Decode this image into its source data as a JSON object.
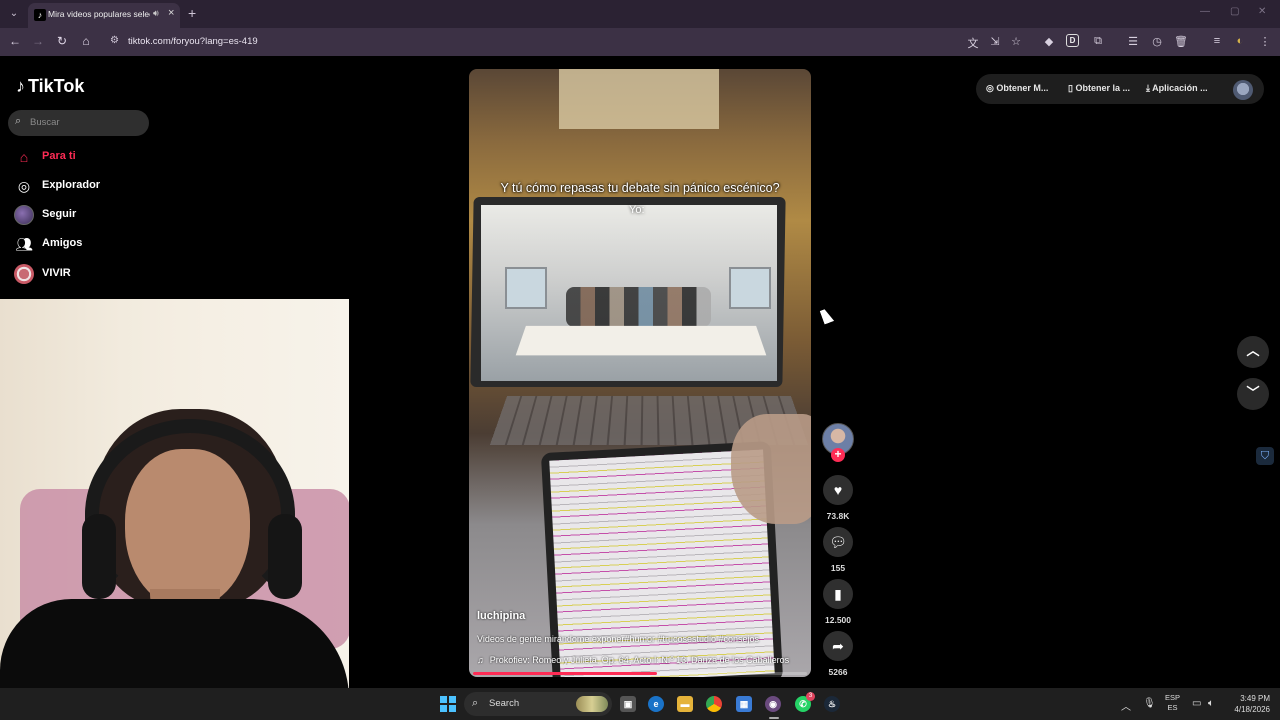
{
  "browser": {
    "tab_title": "Mira videos populares seleccionados para ti",
    "tab_favicon": "tiktok-icon",
    "url": "tiktok.com/foryou?lang=es-419"
  },
  "tiktok": {
    "logo_text": "TikTok",
    "search_placeholder": "Buscar",
    "menu": [
      {
        "label": "Para ti",
        "icon": "home-icon",
        "active": true
      },
      {
        "label": "Explorador",
        "icon": "compass-icon",
        "active": false
      },
      {
        "label": "Seguir",
        "icon": "following-avatar",
        "active": false
      },
      {
        "label": "Amigos",
        "icon": "friends-icon",
        "active": false
      },
      {
        "label": "VIVIR",
        "icon": "live-icon",
        "active": false
      }
    ],
    "top_actions": {
      "coins": "Obtener M...",
      "app": "Obtener la ...",
      "download": "Aplicación ..."
    },
    "video": {
      "caption": "Y tú cómo repasas tu debate sin pánico escénico?",
      "overlay_text": "Yo:",
      "author": "luchipina",
      "description": "Videos de gente mirándome exponer#humor #trucosestudio #consejos",
      "music": "Prokofiev: Romeo y Julieta, Op. 64, Acto I: N.º 13, Danza de los Caballeros",
      "progress": 0.55
    },
    "actions": {
      "likes": "73.8K",
      "comments": "155",
      "saves": "12.500",
      "shares": "5266"
    }
  },
  "taskbar": {
    "search_label": "Search",
    "lang_top": "ESP",
    "lang_bottom": "ES",
    "time": "3:49 PM",
    "date": "4/18/2026",
    "whatsapp_badge": "3"
  },
  "colors": {
    "accent": "#fe2c55",
    "browser_frame": "#3c3145"
  }
}
